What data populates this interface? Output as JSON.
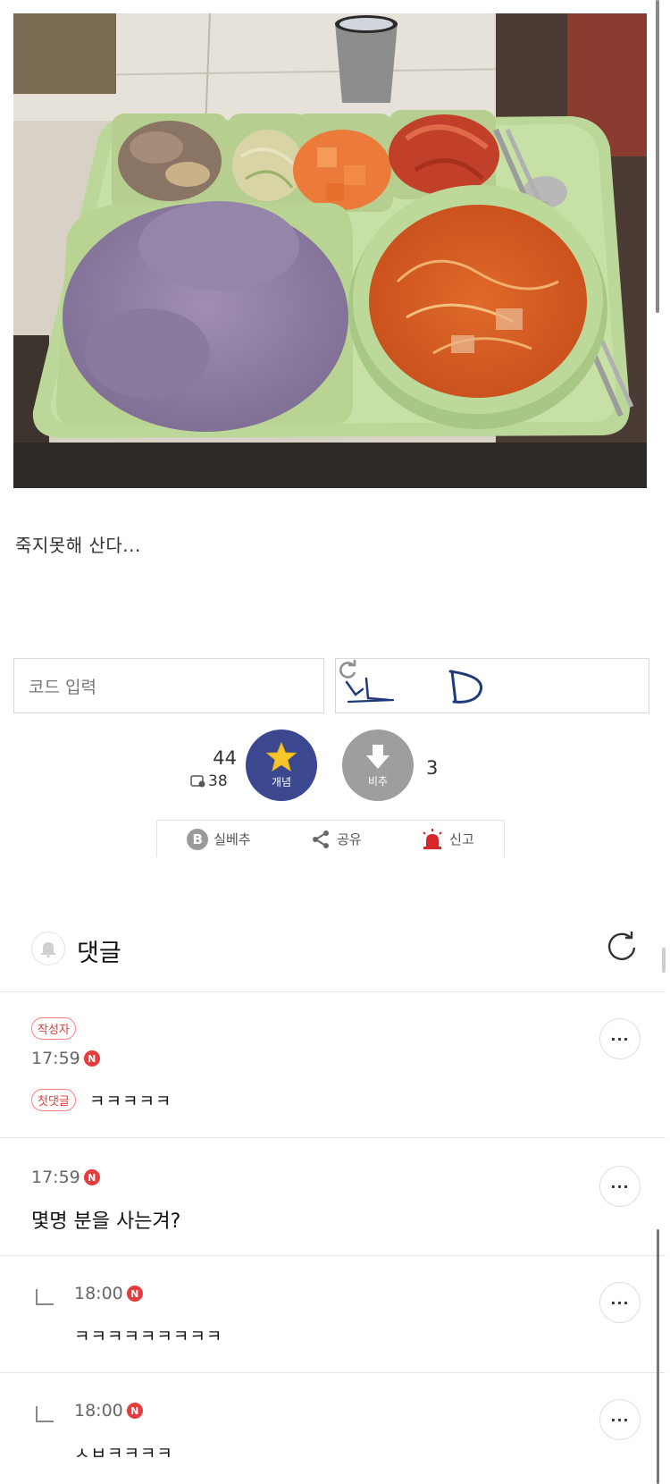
{
  "post": {
    "caption": "죽지못해 산다..."
  },
  "captcha": {
    "placeholder": "코드 입력"
  },
  "vote": {
    "up_count": "44",
    "fix_count": "38",
    "up_label": "개념",
    "down_label": "비추",
    "down_count": "3",
    "up_color": "#3b4890",
    "down_color": "#9e9e9e"
  },
  "actions": {
    "best": "실베추",
    "share": "공유",
    "report": "신고"
  },
  "comments_section": {
    "title": "댓글"
  },
  "comments": [
    {
      "writer_badge": "작성자",
      "time": "17:59",
      "first_badge": "첫댓글",
      "text": "ㅋㅋㅋㅋㅋ"
    },
    {
      "time": "17:59",
      "text": "몇명 분을 사는겨?"
    },
    {
      "time": "18:00",
      "text": "ㅋㅋㅋㅋㅋㅋㅋㅋㅋ"
    },
    {
      "time": "18:00",
      "text": "ㅅㅂㅋㅋㅋㅋ"
    }
  ],
  "icons": {
    "n_badge": "N",
    "b_badge": "B",
    "more": "···"
  }
}
